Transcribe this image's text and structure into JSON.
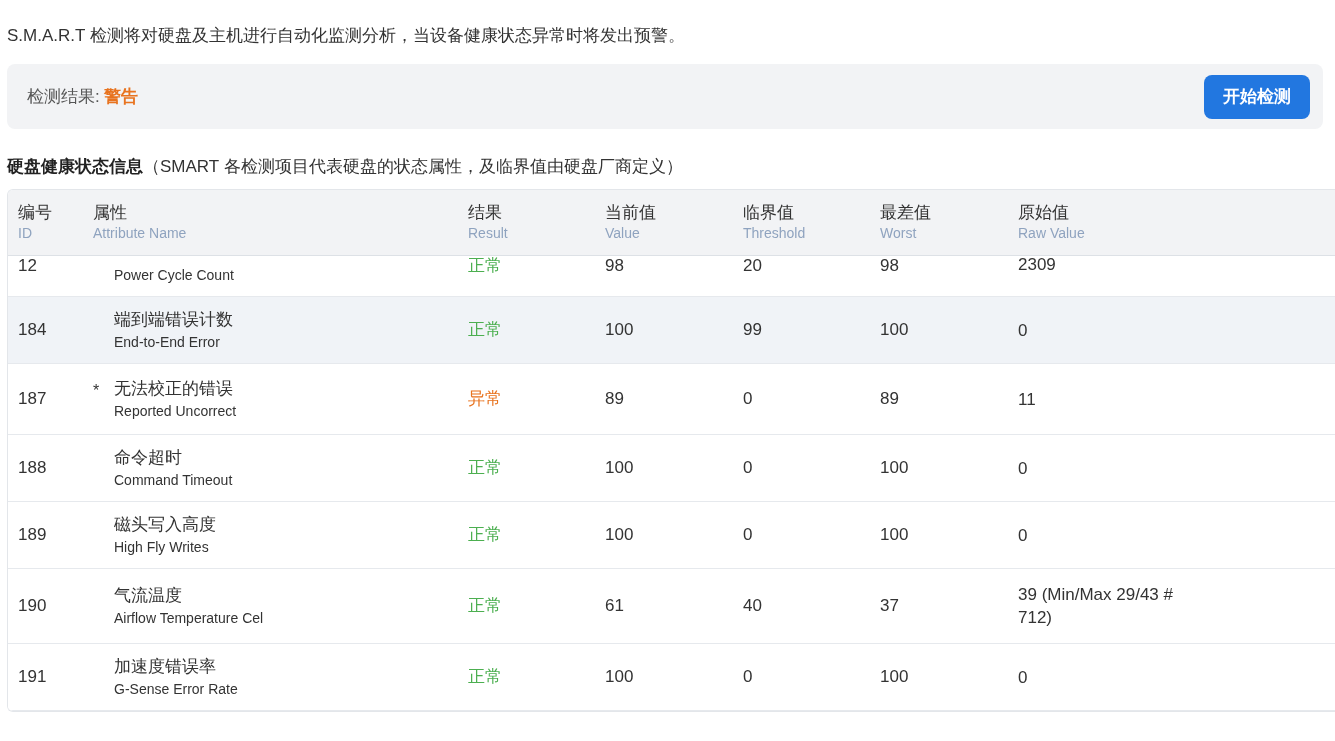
{
  "intro": "S.M.A.R.T 检测将对硬盘及主机进行自动化监测分析，当设备健康状态异常时将发出预警。",
  "result_bar": {
    "label": "检测结果:",
    "value": "警告",
    "kind": "warning",
    "button": "开始检测"
  },
  "section": {
    "title": "硬盘健康状态信息",
    "note": "（SMART 各检测项目代表硬盘的状态属性，及临界值由硬盘厂商定义）"
  },
  "table": {
    "columns": [
      {
        "zh": "编号",
        "en": "ID"
      },
      {
        "zh": "属性",
        "en": "Attribute Name"
      },
      {
        "zh": "结果",
        "en": "Result"
      },
      {
        "zh": "当前值",
        "en": "Value"
      },
      {
        "zh": "临界值",
        "en": "Threshold"
      },
      {
        "zh": "最差值",
        "en": "Worst"
      },
      {
        "zh": "原始值",
        "en": "Raw Value"
      }
    ],
    "rows": [
      {
        "id": "12",
        "name_en": "Power Cycle Count",
        "result": "正常",
        "kind": "normal",
        "value": "98",
        "threshold": "20",
        "worst": "98",
        "raw": "2309",
        "selected": false,
        "cut": true
      },
      {
        "id": "184",
        "name_zh": "端到端错误计数",
        "name_en": "End-to-End Error",
        "result": "正常",
        "kind": "normal",
        "value": "100",
        "threshold": "99",
        "worst": "100",
        "raw": "0",
        "selected": true
      },
      {
        "id": "187",
        "marker": "*",
        "name_zh": "无法校正的错误",
        "name_en": "Reported Uncorrect",
        "result": "异常",
        "kind": "abnormal",
        "value": "89",
        "threshold": "0",
        "worst": "89",
        "raw": "11",
        "selected": false
      },
      {
        "id": "188",
        "name_zh": "命令超时",
        "name_en": "Command Timeout",
        "result": "正常",
        "kind": "normal",
        "value": "100",
        "threshold": "0",
        "worst": "100",
        "raw": "0",
        "selected": false
      },
      {
        "id": "189",
        "name_zh": "磁头写入高度",
        "name_en": "High Fly Writes",
        "result": "正常",
        "kind": "normal",
        "value": "100",
        "threshold": "0",
        "worst": "100",
        "raw": "0",
        "selected": false
      },
      {
        "id": "190",
        "name_zh": "气流温度",
        "name_en": "Airflow Temperature Cel",
        "result": "正常",
        "kind": "normal",
        "value": "61",
        "threshold": "40",
        "worst": "37",
        "raw": "39 (Min/Max 29/43 # 712)",
        "selected": false
      },
      {
        "id": "191",
        "name_zh": "加速度错误率",
        "name_en": "G-Sense Error Rate",
        "result": "正常",
        "kind": "normal",
        "value": "100",
        "threshold": "0",
        "worst": "100",
        "raw": "0",
        "selected": false
      }
    ]
  }
}
